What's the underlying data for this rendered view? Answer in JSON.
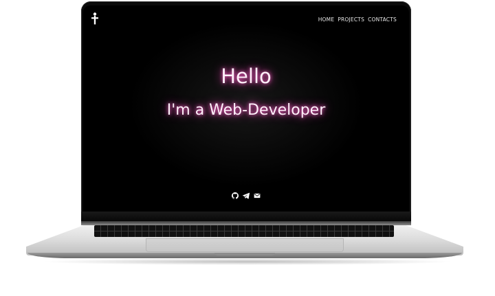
{
  "site": {
    "logo_icon": "cross-icon",
    "nav": [
      {
        "label": "HOME"
      },
      {
        "label": "PROJECTS"
      },
      {
        "label": "CONTACTS"
      }
    ],
    "hero": {
      "greeting": "Hello",
      "subtitle": "I'm a Web-Developer"
    },
    "socials": [
      {
        "icon": "github-icon"
      },
      {
        "icon": "telegram-icon"
      },
      {
        "icon": "mail-icon"
      }
    ],
    "colors": {
      "background": "#000000",
      "text": "#fff0fa",
      "glow": "#ff66cc",
      "nav_text": "#e8e8e8"
    }
  }
}
